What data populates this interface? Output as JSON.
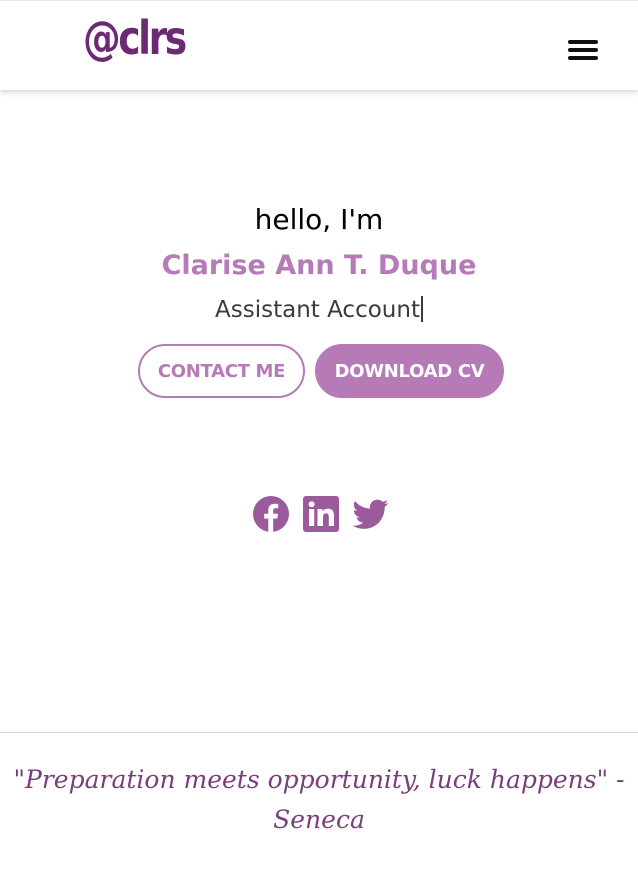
{
  "header": {
    "logo_text": "@clrs",
    "menu_icon": "hamburger-menu-icon"
  },
  "hero": {
    "greeting": "hello, I'm",
    "name": "Clarise Ann T. Duque",
    "role_typed": "Assistant Account"
  },
  "buttons": {
    "contact_label": "CONTACT ME",
    "download_label": "DOWNLOAD CV"
  },
  "social": {
    "icons": [
      "facebook-icon",
      "linkedin-icon",
      "twitter-icon"
    ]
  },
  "footer": {
    "quote": "\"Preparation meets opportunity, luck happens\" - Seneca"
  },
  "colors": {
    "accent": "#b67ab7",
    "logo": "#6d2a73",
    "social_icons": "#9b5a9c",
    "quote": "#7a3e7c"
  }
}
